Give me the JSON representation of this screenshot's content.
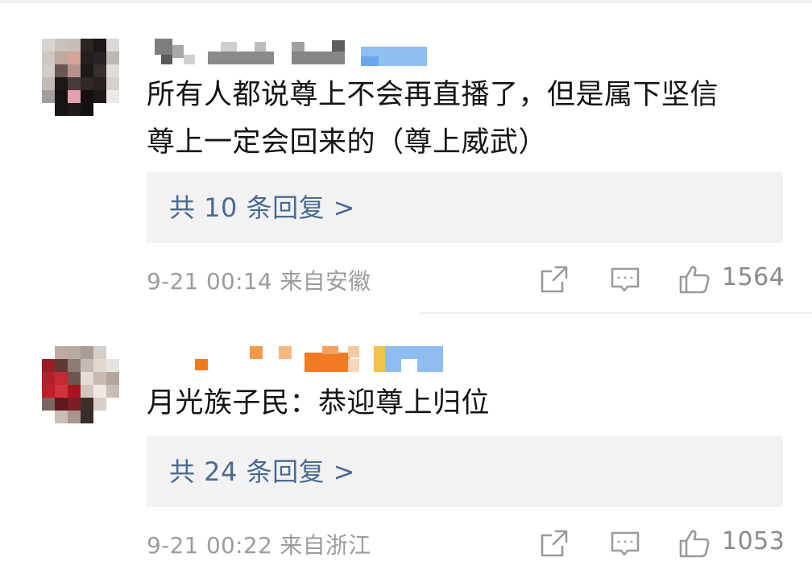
{
  "comments": [
    {
      "text_line1": "所有人都说尊上不会再直播了，但是属下坚信",
      "text_line2": "尊上一定会回来的（尊上威武）",
      "replies_label": "共 10 条回复 >",
      "meta": "9-21 00:14 来自安徽",
      "likes": "1564"
    },
    {
      "text_line1": "月光族子民：恭迎尊上归位",
      "text_line2": "",
      "replies_label": "共 24 条回复 >",
      "meta": "9-21 00:22 来自浙江",
      "likes": "1053"
    }
  ],
  "icons": {
    "share": "share-icon",
    "comment": "comment-icon",
    "like": "like-icon"
  },
  "colors": {
    "reply_link": "#4a6a96",
    "meta_text": "#9c9c9c",
    "reply_box_bg": "#f2f2f2"
  }
}
